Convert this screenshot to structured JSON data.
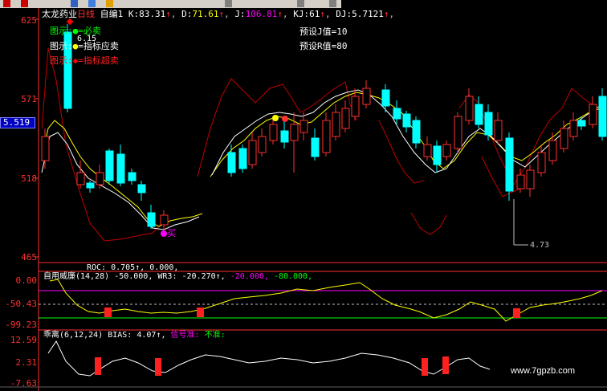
{
  "toolbar": {
    "icons": [
      "up-arrow-icon",
      "down-arrow-icon",
      "crosshair-icon",
      "zoom-icon",
      "page-icon",
      "save-icon",
      "print-icon",
      "help-icon"
    ]
  },
  "header": {
    "stock_name": "太龙药业",
    "period": "日线",
    "indicator_name": "自编1",
    "k_label": "K:",
    "k_value": "83.31",
    "d_label": "D:",
    "d_value": "71.61",
    "j_label": "J:",
    "j_value": "106.81",
    "kj_label": "KJ:",
    "kj_value": "61",
    "dj_label": "DJ:",
    "dj_value": "5.7121"
  },
  "legend": {
    "items": [
      {
        "label": "图示:",
        "dot_text": "●",
        "text": "=必卖",
        "color": "#00ff00"
      },
      {
        "label": "图示:",
        "dot_text": "●",
        "text": "=指标应卖",
        "color": "#ffff00"
      },
      {
        "label": "图示:",
        "dot_text": "◆",
        "text": "=指标超卖",
        "color": "#ff0000"
      }
    ],
    "peak_label": "6.15",
    "preset_j": "预设J值=10",
    "preset_r": "预设R值=80"
  },
  "main_axis": {
    "ticks": [
      "625",
      "571",
      "518",
      "465"
    ],
    "current_price": "5.519"
  },
  "annotations": {
    "buy_text": "买",
    "low_label": "4.73"
  },
  "roc_header": {
    "text": "ROC: 0.705↑, 0.000,"
  },
  "wr_panel": {
    "title": "自用威廉",
    "params": "(14,28)",
    "value1": "-50.000,",
    "wr3_label": "WR3:",
    "wr3_value": "-20.270↑,",
    "value2": "-20.000,",
    "value3": "-80.000,",
    "ticks": [
      "0.00",
      "-50.43",
      "-99.23"
    ],
    "colors": {
      "wr_line": "#ffff00",
      "upper_line": "#ff00ff",
      "lower_line": "#00ff00"
    }
  },
  "bias_panel": {
    "title": "乖离",
    "params": "(6,12,24)",
    "bias_label": "BIAS:",
    "bias_value": "4.07↑,",
    "signal_text": "信号准:",
    "not_accurate_text": "不准:",
    "ticks": [
      "12.59",
      "2.31",
      "-7.63"
    ]
  },
  "watermark": "www.7gpzb.com",
  "colors": {
    "up": "#ff3030",
    "down": "#00ffff",
    "axis": "#ff3030",
    "ma_white": "#ffffff",
    "ma_yellow": "#ffff00",
    "band_red": "#c00000",
    "purple": "#ff00ff"
  }
}
